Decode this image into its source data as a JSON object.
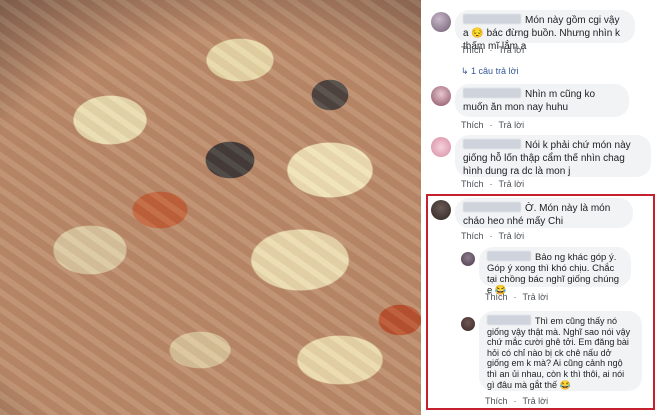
{
  "photo": {
    "alt": ""
  },
  "actions": {
    "like": "Thích",
    "dot": "·",
    "reply": "Trả lời"
  },
  "comments": [
    {
      "text": "Món này gồm cgi vậy a 😔 bác đừng buồn. Nhưng nhìn k thấm mĩ lắm a"
    },
    {
      "reply_count": "1 câu trả lời"
    },
    {
      "text": "Nhìn m cũng ko muốn ăn mon nay huhu"
    },
    {
      "text": "Nói k phải chứ món này giống hỗ lốn thập cẩm thế nhìn chag hình dung ra dc là mon j"
    },
    {
      "text": "Ờ. Món này là món cháo heo nhé mấy Chi"
    },
    {
      "text": "Bảo ng khác góp ý. Góp ý xong thì khó chịu. Chắc tại chồng bác nghĩ giống chúng e 😂"
    },
    {
      "text": "Thì em cũng thấy nó giống vậy thật mà. Nghĩ sao nói vậy chứ mắc cười ghê tởi. Em đăng bài hỏi có chỉ nào bị ck chê nấu dở giống em k mà? Ai cũng cảnh ngộ thì an ủi nhau, còn k thì thôi, ai nói gì đâu mà gắt thế 😂"
    }
  ],
  "colors": {
    "highlight": "#c5202e",
    "link": "#365899",
    "bubble": "#f2f3f5"
  }
}
